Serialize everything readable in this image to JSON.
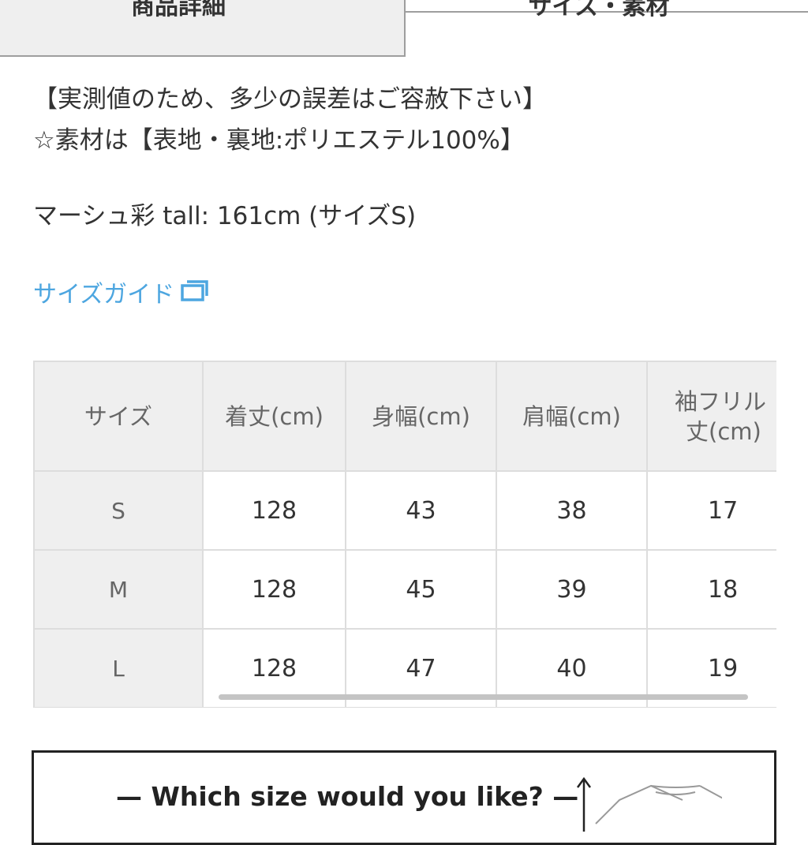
{
  "tabs": {
    "details": "商品詳細",
    "size_material": "サイズ・素材"
  },
  "description": {
    "line1": "【実測値のため、多少の誤差はご容赦下さい】",
    "line2": "☆素材は【表地・裏地:ポリエステル100%】",
    "model": "マーシュ彩 tall: 161cm (サイズS)"
  },
  "size_guide": {
    "label": "サイズガイド",
    "color": "#4da6e0"
  },
  "size_table": {
    "headers": [
      "サイズ",
      "着丈(cm)",
      "身幅(cm)",
      "肩幅(cm)",
      "袖フリル\n丈(cm)"
    ],
    "header_cols": {
      "size": "サイズ",
      "length": "着丈(cm)",
      "width": "身幅(cm)",
      "shoulder": "肩幅(cm)",
      "sleeve_line1": "袖フリル",
      "sleeve_line2": "丈(cm)"
    },
    "rows": [
      {
        "size": "S",
        "length": "128",
        "width": "43",
        "shoulder": "38",
        "sleeve": "17"
      },
      {
        "size": "M",
        "length": "128",
        "width": "45",
        "shoulder": "39",
        "sleeve": "18"
      },
      {
        "size": "L",
        "length": "128",
        "width": "47",
        "shoulder": "40",
        "sleeve": "19"
      }
    ]
  },
  "banner": {
    "text": "— Which size would you like? —"
  }
}
